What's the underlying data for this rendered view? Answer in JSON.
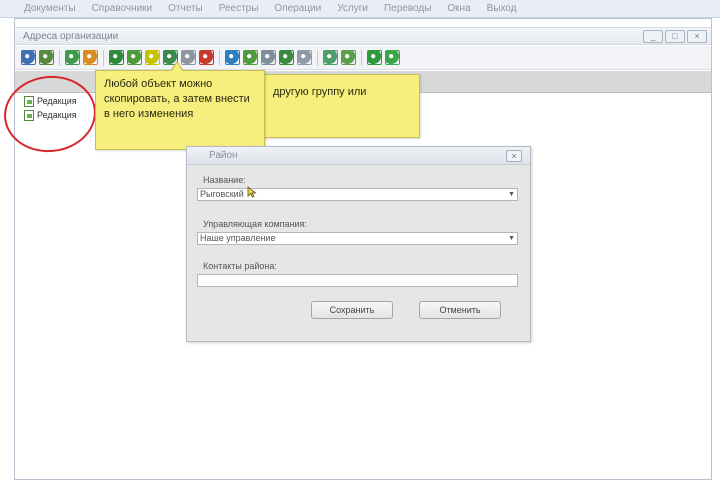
{
  "menubar": {
    "items": [
      "Документы",
      "Справочники",
      "Отчеты",
      "Реестры",
      "Операции",
      "Услуги",
      "Переводы",
      "Окна",
      "Выход"
    ]
  },
  "window": {
    "title": "Адреса организации",
    "controls": [
      "_",
      "□",
      "×"
    ]
  },
  "toolbar": {
    "icons": [
      {
        "name": "save-icon",
        "color": "#3f6fb0"
      },
      {
        "name": "print-icon",
        "color": "#5a8a3c"
      },
      {
        "name": "refresh-icon",
        "color": "#3c9a4a"
      },
      {
        "name": "folder-icon",
        "color": "#d98c1f"
      },
      {
        "name": "add-icon",
        "color": "#2e8b3a"
      },
      {
        "name": "edit-icon",
        "color": "#4e9b3c"
      },
      {
        "name": "copy-icon",
        "color": "#c7c200"
      },
      {
        "name": "move-icon",
        "color": "#3c8a4a"
      },
      {
        "name": "table-icon",
        "color": "#8d969f"
      },
      {
        "name": "delete-icon",
        "color": "#c83a2e"
      },
      {
        "name": "search-icon",
        "color": "#2f7fbf"
      },
      {
        "name": "filter-icon",
        "color": "#4f9a3c"
      },
      {
        "name": "sort-icon",
        "color": "#7f8f9a"
      },
      {
        "name": "export-icon",
        "color": "#3b8a3b"
      },
      {
        "name": "grid-icon",
        "color": "#8e9aa6"
      },
      {
        "name": "window-icon",
        "color": "#4f9f6a"
      },
      {
        "name": "window2-icon",
        "color": "#5aa04a"
      },
      {
        "name": "help-icon",
        "color": "#2f9a3c"
      },
      {
        "name": "exit-icon",
        "color": "#3aa64a"
      }
    ]
  },
  "tree": {
    "items": [
      {
        "label": "Редакция"
      },
      {
        "label": "Редакция"
      }
    ]
  },
  "callouts": {
    "front": "Любой объект можно скопировать, а затем внести в него изменения",
    "back": "другую группу или"
  },
  "dialog": {
    "title": "Район",
    "close": "×",
    "fields": [
      {
        "label": "Название:",
        "value": "Рыговский",
        "has_dropdown": true
      },
      {
        "label": "Управляющая компания:",
        "value": "Наше управление",
        "has_dropdown": true
      },
      {
        "label": "Контакты района:",
        "value": "",
        "has_dropdown": false
      }
    ],
    "buttons": {
      "save": "Сохранить",
      "cancel": "Отменить"
    }
  },
  "colors": {
    "annotation_red": "#d8262a",
    "callout_yellow": "#f7ef7d"
  }
}
